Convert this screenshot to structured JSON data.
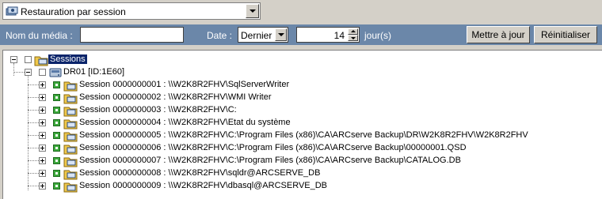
{
  "combo": {
    "value": "Restauration par session",
    "icon": "restore-session-icon"
  },
  "filter": {
    "media_label": "Nom du média :",
    "media_value": "",
    "date_label": "Date :",
    "date_option": "Dernier",
    "days_value": "14",
    "days_unit": "jour(s)",
    "update_button": "Mettre à jour",
    "reset_button": "Réinitialiser",
    "bar_color": "#6b87a9"
  },
  "tree": {
    "root_label": "Sessions",
    "server_label": "DR01 [ID:1E60]",
    "sessions": [
      "Session 0000000001 : \\\\W2K8R2FHV\\SqlServerWriter",
      "Session 0000000002 : \\\\W2K8R2FHV\\WMI Writer",
      "Session 0000000003 : \\\\W2K8R2FHV\\C:",
      "Session 0000000004 : \\\\W2K8R2FHV\\Etat du système",
      "Session 0000000005 : \\\\W2K8R2FHV\\C:\\Program Files (x86)\\CA\\ARCserve Backup\\DR\\W2K8R2FHV\\W2K8R2FHV",
      "Session 0000000006 : \\\\W2K8R2FHV\\C:\\Program Files (x86)\\CA\\ARCserve Backup\\00000001.QSD",
      "Session 0000000007 : \\\\W2K8R2FHV\\C:\\Program Files (x86)\\CA\\ARCserve Backup\\CATALOG.DB",
      "Session 0000000008 : \\\\W2K8R2FHV\\sqldr@ARCSERVE_DB",
      "Session 0000000009 : \\\\W2K8R2FHV\\dbasql@ARCSERVE_DB"
    ]
  }
}
